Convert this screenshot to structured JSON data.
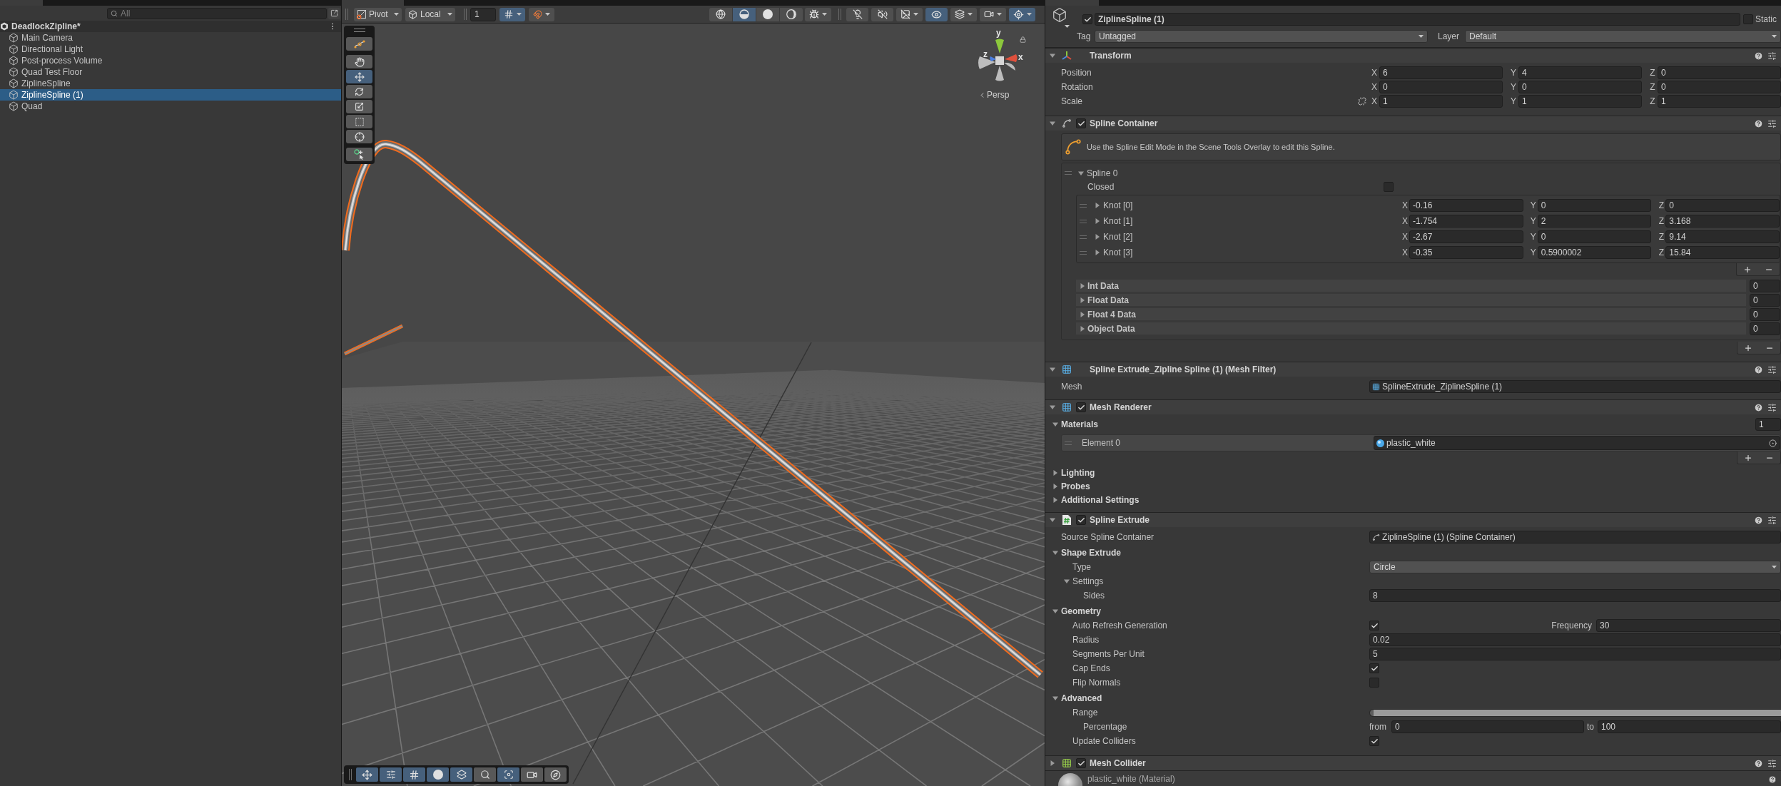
{
  "hierarchy": {
    "search": {
      "placeholder": "All"
    },
    "scene": "DeadlockZipline*",
    "items": [
      {
        "label": "Main Camera",
        "selected": false
      },
      {
        "label": "Directional Light",
        "selected": false
      },
      {
        "label": "Post-process Volume",
        "selected": false
      },
      {
        "label": "Quad Test Floor",
        "selected": false
      },
      {
        "label": "ZiplineSpline",
        "selected": false
      },
      {
        "label": "ZiplineSpline (1)",
        "selected": true
      },
      {
        "label": "Quad",
        "selected": false
      }
    ]
  },
  "scene_view": {
    "toolbar": {
      "pivot": "Pivot",
      "space": "Local",
      "grid_size": "1",
      "snap_buttons": [
        {
          "kind": "grid-snap",
          "selected": true
        },
        {
          "kind": "increment-snap",
          "selected": false
        }
      ],
      "draw_modes": [
        {
          "kind": "wireframe",
          "selected": false
        },
        {
          "kind": "shaded",
          "selected": true
        },
        {
          "kind": "unlit",
          "selected": false
        },
        {
          "kind": "lit",
          "selected": false
        }
      ],
      "view_buttons": [
        {
          "kind": "debug",
          "selected": false,
          "dropdown": true
        },
        {
          "kind": "lighting",
          "selected": false,
          "dropdown": false
        },
        {
          "kind": "audio",
          "selected": false,
          "dropdown": false
        },
        {
          "kind": "effects",
          "selected": false,
          "dropdown": true
        },
        {
          "kind": "visibility",
          "selected": true,
          "dropdown": false
        },
        {
          "kind": "layers",
          "selected": false,
          "dropdown": true
        },
        {
          "kind": "camera",
          "selected": false,
          "dropdown": true
        },
        {
          "kind": "gizmos",
          "selected": true,
          "dropdown": true
        }
      ]
    },
    "tools": [
      {
        "kind": "spline",
        "selected": false
      },
      {
        "kind": "hand",
        "selected": false
      },
      {
        "kind": "move",
        "selected": true
      },
      {
        "kind": "rotate",
        "selected": false
      },
      {
        "kind": "scale",
        "selected": false
      },
      {
        "kind": "rect",
        "selected": false
      },
      {
        "kind": "transform",
        "selected": false
      },
      {
        "kind": "custom",
        "selected": false
      }
    ],
    "gizmo": {
      "y": "y",
      "z": "z",
      "x": "x",
      "projection": "Persp"
    },
    "overlay_buttons": [
      {
        "kind": "move",
        "selected": true
      },
      {
        "kind": "sliders",
        "selected": true
      },
      {
        "kind": "grid",
        "selected": true
      },
      {
        "kind": "sphere",
        "selected": true
      },
      {
        "kind": "layers",
        "selected": true
      },
      {
        "kind": "search",
        "selected": false
      },
      {
        "kind": "focus",
        "selected": true
      },
      {
        "kind": "camera",
        "selected": false
      },
      {
        "kind": "compass",
        "selected": false
      }
    ]
  },
  "inspector": {
    "object": {
      "active": true,
      "name": "ZiplineSpline (1)",
      "static": false,
      "static_label": "Static",
      "tag_label": "Tag",
      "tag": "Untagged",
      "layer_label": "Layer",
      "layer": "Default"
    },
    "transform": {
      "title": "Transform",
      "expanded": true,
      "rows": [
        {
          "label": "Position",
          "values": [
            {
              "axis": "X",
              "value": "6"
            },
            {
              "axis": "Y",
              "value": "4"
            },
            {
              "axis": "Z",
              "value": "0"
            }
          ]
        },
        {
          "label": "Rotation",
          "values": [
            {
              "axis": "X",
              "value": "0"
            },
            {
              "axis": "Y",
              "value": "0"
            },
            {
              "axis": "Z",
              "value": "0"
            }
          ]
        },
        {
          "label": "Scale",
          "linked": false,
          "values": [
            {
              "axis": "X",
              "value": "1"
            },
            {
              "axis": "Y",
              "value": "1"
            },
            {
              "axis": "Z",
              "value": "1"
            }
          ]
        }
      ]
    },
    "spline_container": {
      "title": "Spline Container",
      "enabled": true,
      "expanded": true,
      "info": "Use the Spline Edit Mode in the Scene Tools Overlay to edit this Spline.",
      "splines": [
        {
          "title": "Spline 0",
          "expanded": true,
          "closed_label": "Closed",
          "closed": false,
          "knots": [
            {
              "label": "Knot [0]",
              "expanded": false,
              "values": [
                {
                  "axis": "X",
                  "value": "-0.16"
                },
                {
                  "axis": "Y",
                  "value": "0"
                },
                {
                  "axis": "Z",
                  "value": "0"
                }
              ]
            },
            {
              "label": "Knot [1]",
              "expanded": false,
              "values": [
                {
                  "axis": "X",
                  "value": "-1.754"
                },
                {
                  "axis": "Y",
                  "value": "2"
                },
                {
                  "axis": "Z",
                  "value": "3.168"
                }
              ]
            },
            {
              "label": "Knot [2]",
              "expanded": false,
              "values": [
                {
                  "axis": "X",
                  "value": "-2.67"
                },
                {
                  "axis": "Y",
                  "value": "0"
                },
                {
                  "axis": "Z",
                  "value": "9.14"
                }
              ]
            },
            {
              "label": "Knot [3]",
              "expanded": false,
              "values": [
                {
                  "axis": "X",
                  "value": "-0.35"
                },
                {
                  "axis": "Y",
                  "value": "0.5900002"
                },
                {
                  "axis": "Z",
                  "value": "15.84"
                }
              ]
            }
          ],
          "data": [
            {
              "label": "Int Data",
              "expanded": false,
              "count": "0"
            },
            {
              "label": "Float Data",
              "expanded": false,
              "count": "0"
            },
            {
              "label": "Float 4 Data",
              "expanded": false,
              "count": "0"
            },
            {
              "label": "Object Data",
              "expanded": false,
              "count": "0"
            }
          ]
        }
      ]
    },
    "mesh_filter": {
      "title": "Spline Extrude_Zipline Spline (1) (Mesh Filter)",
      "expanded": true,
      "rows": [
        {
          "label": "Mesh",
          "value": "SplineExtrude_ZiplineSpline (1)"
        }
      ]
    },
    "mesh_renderer": {
      "title": "Mesh Renderer",
      "enabled": true,
      "expanded": true,
      "materials": {
        "label": "Materials",
        "expanded": true,
        "count": "1",
        "elements": [
          {
            "label": "Element 0",
            "value": "plastic_white"
          }
        ]
      },
      "sections": [
        {
          "label": "Lighting",
          "expanded": false
        },
        {
          "label": "Probes",
          "expanded": false
        },
        {
          "label": "Additional Settings",
          "expanded": false
        }
      ]
    },
    "spline_extrude": {
      "title": "Spline Extrude",
      "enabled": true,
      "expanded": true,
      "rows": [
        {
          "kind": "object",
          "label": "Source Spline Container",
          "value": "ZiplineSpline (1) (Spline Container)"
        },
        {
          "kind": "foldout",
          "label": "Shape Extrude",
          "expanded": true,
          "children": [
            {
              "kind": "dropdown",
              "label": "Type",
              "value": "Circle"
            },
            {
              "kind": "foldout",
              "label": "Settings",
              "expanded": true,
              "children": [
                {
                  "kind": "number",
                  "label": "Sides",
                  "value": "8"
                }
              ]
            }
          ]
        },
        {
          "kind": "foldout",
          "label": "Geometry",
          "expanded": true,
          "children": [
            {
              "kind": "checkbox",
              "label": "Auto Refresh Generation",
              "checked": true,
              "extra_label": "Frequency",
              "extra_value": "30"
            },
            {
              "kind": "number",
              "label": "Radius",
              "value": "0.02"
            },
            {
              "kind": "number",
              "label": "Segments Per Unit",
              "value": "5"
            },
            {
              "kind": "checkbox",
              "label": "Cap Ends",
              "checked": true
            },
            {
              "kind": "checkbox",
              "label": "Flip Normals",
              "checked": false
            }
          ]
        },
        {
          "kind": "foldout",
          "label": "Advanced",
          "expanded": true,
          "children": [
            {
              "kind": "range",
              "label": "Range",
              "level": 1,
              "children": [
                {
                  "kind": "from-to",
                  "label": "Percentage",
                  "from_label": "from",
                  "from": "0",
                  "to_label": "to",
                  "to": "100"
                }
              ]
            },
            {
              "kind": "checkbox",
              "label": "Update Colliders",
              "checked": true
            }
          ]
        }
      ]
    },
    "mesh_collider": {
      "title": "Mesh Collider",
      "enabled": true,
      "expanded": false
    },
    "material": {
      "name": "plastic_white (Material)"
    }
  }
}
